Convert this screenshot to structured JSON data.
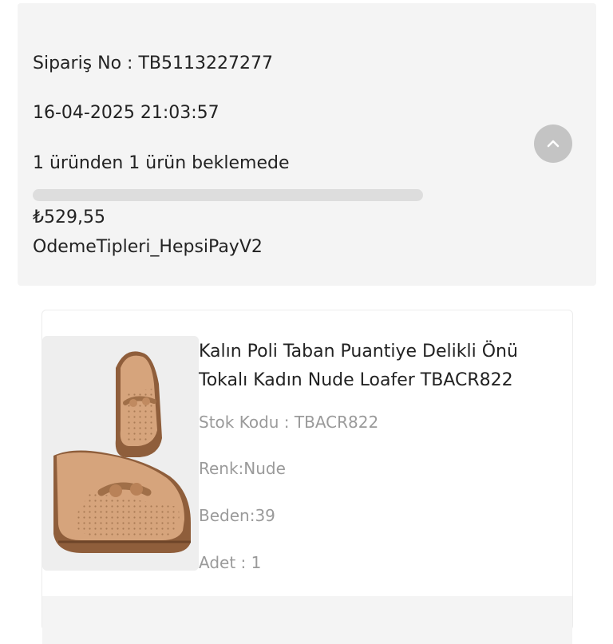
{
  "order": {
    "number_line": "Sipariş No : TB5113227277",
    "date_line": "16-04-2025 21:03:57",
    "status_line": "1 üründen 1 ürün beklemede",
    "progress_fraction": 0,
    "price_line": "₺529,55",
    "payment_line": "OdemeTipleri_HepsiPayV2",
    "collapse_icon": "chevron-up-icon"
  },
  "product": {
    "title": "Kalın Poli Taban Puantiye Delikli Önü Tokalı Kadın Nude Loafer TBACR822",
    "stock_code": "Stok Kodu : TBACR822",
    "color": "Renk:Nude",
    "size": "Beden:39",
    "quantity": "Adet : 1"
  },
  "colors": {
    "panel": "#f4f4f4",
    "shoe_upper": "#d6a47c",
    "shoe_sole": "#8f5e3b"
  }
}
